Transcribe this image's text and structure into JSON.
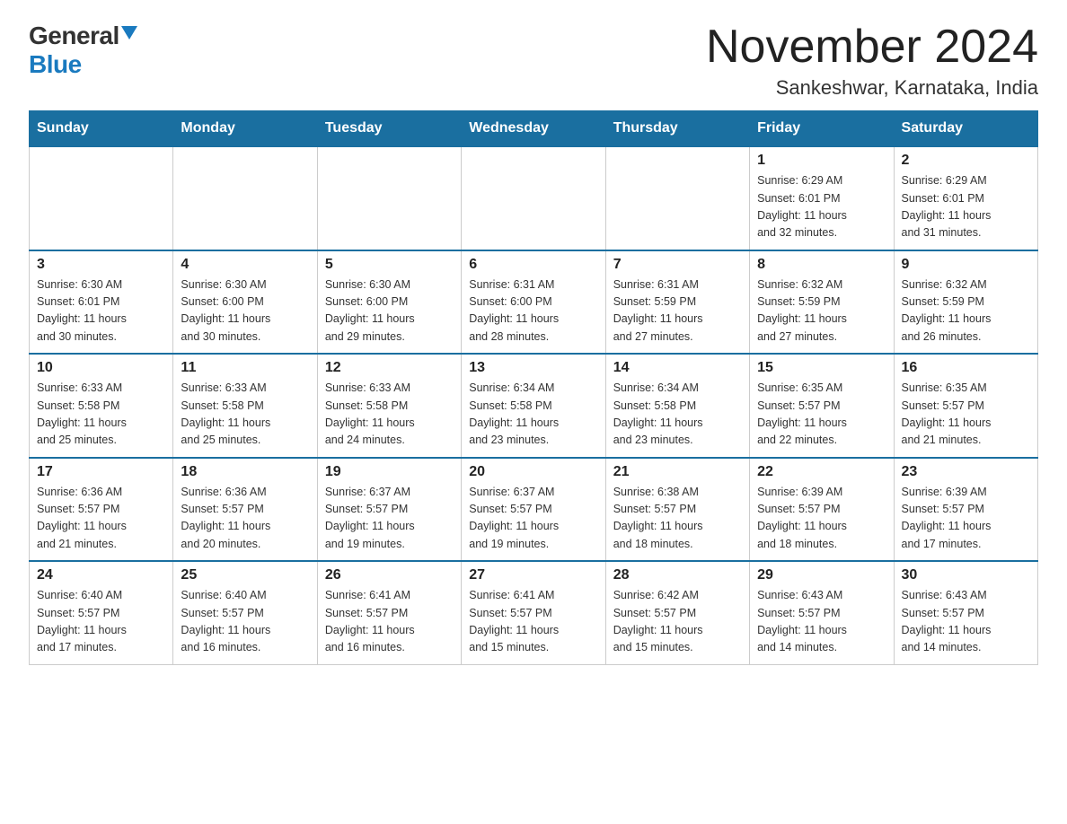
{
  "logo": {
    "general": "General",
    "blue": "Blue"
  },
  "title": "November 2024",
  "subtitle": "Sankeshwar, Karnataka, India",
  "days_of_week": [
    "Sunday",
    "Monday",
    "Tuesday",
    "Wednesday",
    "Thursday",
    "Friday",
    "Saturday"
  ],
  "weeks": [
    [
      {
        "day": "",
        "info": ""
      },
      {
        "day": "",
        "info": ""
      },
      {
        "day": "",
        "info": ""
      },
      {
        "day": "",
        "info": ""
      },
      {
        "day": "",
        "info": ""
      },
      {
        "day": "1",
        "info": "Sunrise: 6:29 AM\nSunset: 6:01 PM\nDaylight: 11 hours\nand 32 minutes."
      },
      {
        "day": "2",
        "info": "Sunrise: 6:29 AM\nSunset: 6:01 PM\nDaylight: 11 hours\nand 31 minutes."
      }
    ],
    [
      {
        "day": "3",
        "info": "Sunrise: 6:30 AM\nSunset: 6:01 PM\nDaylight: 11 hours\nand 30 minutes."
      },
      {
        "day": "4",
        "info": "Sunrise: 6:30 AM\nSunset: 6:00 PM\nDaylight: 11 hours\nand 30 minutes."
      },
      {
        "day": "5",
        "info": "Sunrise: 6:30 AM\nSunset: 6:00 PM\nDaylight: 11 hours\nand 29 minutes."
      },
      {
        "day": "6",
        "info": "Sunrise: 6:31 AM\nSunset: 6:00 PM\nDaylight: 11 hours\nand 28 minutes."
      },
      {
        "day": "7",
        "info": "Sunrise: 6:31 AM\nSunset: 5:59 PM\nDaylight: 11 hours\nand 27 minutes."
      },
      {
        "day": "8",
        "info": "Sunrise: 6:32 AM\nSunset: 5:59 PM\nDaylight: 11 hours\nand 27 minutes."
      },
      {
        "day": "9",
        "info": "Sunrise: 6:32 AM\nSunset: 5:59 PM\nDaylight: 11 hours\nand 26 minutes."
      }
    ],
    [
      {
        "day": "10",
        "info": "Sunrise: 6:33 AM\nSunset: 5:58 PM\nDaylight: 11 hours\nand 25 minutes."
      },
      {
        "day": "11",
        "info": "Sunrise: 6:33 AM\nSunset: 5:58 PM\nDaylight: 11 hours\nand 25 minutes."
      },
      {
        "day": "12",
        "info": "Sunrise: 6:33 AM\nSunset: 5:58 PM\nDaylight: 11 hours\nand 24 minutes."
      },
      {
        "day": "13",
        "info": "Sunrise: 6:34 AM\nSunset: 5:58 PM\nDaylight: 11 hours\nand 23 minutes."
      },
      {
        "day": "14",
        "info": "Sunrise: 6:34 AM\nSunset: 5:58 PM\nDaylight: 11 hours\nand 23 minutes."
      },
      {
        "day": "15",
        "info": "Sunrise: 6:35 AM\nSunset: 5:57 PM\nDaylight: 11 hours\nand 22 minutes."
      },
      {
        "day": "16",
        "info": "Sunrise: 6:35 AM\nSunset: 5:57 PM\nDaylight: 11 hours\nand 21 minutes."
      }
    ],
    [
      {
        "day": "17",
        "info": "Sunrise: 6:36 AM\nSunset: 5:57 PM\nDaylight: 11 hours\nand 21 minutes."
      },
      {
        "day": "18",
        "info": "Sunrise: 6:36 AM\nSunset: 5:57 PM\nDaylight: 11 hours\nand 20 minutes."
      },
      {
        "day": "19",
        "info": "Sunrise: 6:37 AM\nSunset: 5:57 PM\nDaylight: 11 hours\nand 19 minutes."
      },
      {
        "day": "20",
        "info": "Sunrise: 6:37 AM\nSunset: 5:57 PM\nDaylight: 11 hours\nand 19 minutes."
      },
      {
        "day": "21",
        "info": "Sunrise: 6:38 AM\nSunset: 5:57 PM\nDaylight: 11 hours\nand 18 minutes."
      },
      {
        "day": "22",
        "info": "Sunrise: 6:39 AM\nSunset: 5:57 PM\nDaylight: 11 hours\nand 18 minutes."
      },
      {
        "day": "23",
        "info": "Sunrise: 6:39 AM\nSunset: 5:57 PM\nDaylight: 11 hours\nand 17 minutes."
      }
    ],
    [
      {
        "day": "24",
        "info": "Sunrise: 6:40 AM\nSunset: 5:57 PM\nDaylight: 11 hours\nand 17 minutes."
      },
      {
        "day": "25",
        "info": "Sunrise: 6:40 AM\nSunset: 5:57 PM\nDaylight: 11 hours\nand 16 minutes."
      },
      {
        "day": "26",
        "info": "Sunrise: 6:41 AM\nSunset: 5:57 PM\nDaylight: 11 hours\nand 16 minutes."
      },
      {
        "day": "27",
        "info": "Sunrise: 6:41 AM\nSunset: 5:57 PM\nDaylight: 11 hours\nand 15 minutes."
      },
      {
        "day": "28",
        "info": "Sunrise: 6:42 AM\nSunset: 5:57 PM\nDaylight: 11 hours\nand 15 minutes."
      },
      {
        "day": "29",
        "info": "Sunrise: 6:43 AM\nSunset: 5:57 PM\nDaylight: 11 hours\nand 14 minutes."
      },
      {
        "day": "30",
        "info": "Sunrise: 6:43 AM\nSunset: 5:57 PM\nDaylight: 11 hours\nand 14 minutes."
      }
    ]
  ]
}
